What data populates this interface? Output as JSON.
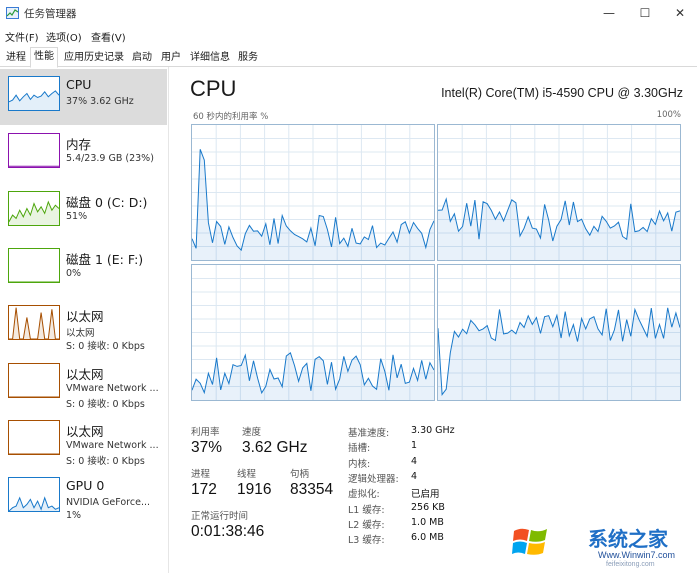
{
  "window": {
    "title": "任务管理器",
    "minimize": "—",
    "maximize": "☐",
    "close": "✕"
  },
  "menu": [
    "文件(F)",
    "选项(O)",
    "查看(V)"
  ],
  "tabs": [
    "进程",
    "性能",
    "应用历史记录",
    "启动",
    "用户",
    "详细信息",
    "服务"
  ],
  "active_tab": "性能",
  "sidebar": [
    {
      "title": "CPU",
      "sub1": "37%  3.62 GHz",
      "sub2": "",
      "color": "#1979ca",
      "selected": true
    },
    {
      "title": "内存",
      "sub1": "5.4/23.9 GB (23%)",
      "sub2": "",
      "color": "#8b12ae",
      "selected": false
    },
    {
      "title": "磁盘 0 (C: D:)",
      "sub1": "51%",
      "sub2": "",
      "color": "#4da60c",
      "selected": false
    },
    {
      "title": "磁盘 1 (E: F:)",
      "sub1": "0%",
      "sub2": "",
      "color": "#4da60c",
      "selected": false
    },
    {
      "title": "以太网",
      "sub1": "以太网",
      "sub2": "S: 0  接收: 0 Kbps",
      "color": "#a74f01",
      "selected": false
    },
    {
      "title": "以太网",
      "sub1": "VMware Network ...",
      "sub2": "S: 0  接收: 0 Kbps",
      "color": "#a74f01",
      "selected": false
    },
    {
      "title": "以太网",
      "sub1": "VMware Network ...",
      "sub2": "S: 0  接收: 0 Kbps",
      "color": "#a74f01",
      "selected": false
    },
    {
      "title": "GPU 0",
      "sub1": "NVIDIA GeForce...",
      "sub2": "1%",
      "color": "#1979ca",
      "selected": false
    }
  ],
  "main": {
    "title": "CPU",
    "model": "Intel(R) Core(TM) i5-4590 CPU @ 3.30GHz",
    "graph_caption": "60 秒内的利用率 %",
    "graph_max": "100%",
    "graph_color": "#1979ca",
    "stats": {
      "util_label": "利用率",
      "util_value": "37%",
      "speed_label": "速度",
      "speed_value": "3.62 GHz",
      "proc_label": "进程",
      "proc_value": "172",
      "thread_label": "线程",
      "thread_value": "1916",
      "handle_label": "句柄",
      "handle_value": "83354",
      "uptime_label": "正常运行时间",
      "uptime_value": "0:01:38:46"
    },
    "details": [
      {
        "key": "基准速度:",
        "value": "3.30 GHz"
      },
      {
        "key": "插槽:",
        "value": "1"
      },
      {
        "key": "内核:",
        "value": "4"
      },
      {
        "key": "逻辑处理器:",
        "value": "4"
      },
      {
        "key": "虚拟化:",
        "value": "已启用"
      },
      {
        "key": "L1 缓存:",
        "value": "256 KB"
      },
      {
        "key": "L2 缓存:",
        "value": "1.0 MB"
      },
      {
        "key": "L3 缓存:",
        "value": "6.0 MB"
      }
    ]
  },
  "watermark": {
    "brand": "系统之家",
    "site": "Www.Winwin7.com",
    "sub": "feifeixitong.com"
  }
}
